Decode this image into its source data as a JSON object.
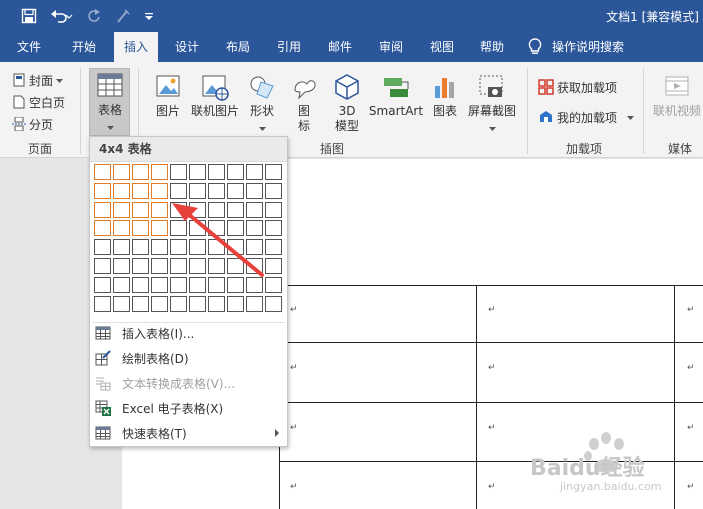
{
  "title_bar": {
    "document_title": "文档1 [兼容模式]",
    "quick_access": [
      {
        "icon": "save-icon"
      },
      {
        "icon": "undo-icon"
      },
      {
        "icon": "redo-icon"
      },
      {
        "icon": "format-painter-icon"
      },
      {
        "icon": "customize-qat-icon"
      }
    ]
  },
  "tabs": [
    {
      "label": "文件"
    },
    {
      "label": "开始"
    },
    {
      "label": "插入",
      "active": true
    },
    {
      "label": "设计"
    },
    {
      "label": "布局"
    },
    {
      "label": "引用"
    },
    {
      "label": "邮件"
    },
    {
      "label": "审阅"
    },
    {
      "label": "视图"
    },
    {
      "label": "帮助"
    },
    {
      "label": "操作说明搜索",
      "icon": "lightbulb-icon"
    }
  ],
  "ribbon": {
    "pages_group": {
      "label": "页面",
      "items": [
        {
          "label": "封面",
          "icon": "cover-page-icon",
          "has_dropdown": true
        },
        {
          "label": "空白页",
          "icon": "blank-page-icon"
        },
        {
          "label": "分页",
          "icon": "page-break-icon"
        }
      ]
    },
    "table_button": {
      "label": "表格",
      "icon": "table-icon"
    },
    "illustrations_group": {
      "label": "插图",
      "items": [
        {
          "label": "图片",
          "icon": "picture-icon"
        },
        {
          "label": "联机图片",
          "icon": "online-picture-icon"
        },
        {
          "label": "形状",
          "icon": "shapes-icon",
          "has_dropdown": true
        },
        {
          "label_line1": "图",
          "label_line2": "标",
          "icon": "icons-icon"
        },
        {
          "label_line1": "3D",
          "label_line2": "模型",
          "icon": "3d-model-icon"
        },
        {
          "label": "SmartArt",
          "icon": "smartart-icon"
        },
        {
          "label": "图表",
          "icon": "chart-icon"
        },
        {
          "label": "屏幕截图",
          "icon": "screenshot-icon",
          "has_dropdown": true
        }
      ]
    },
    "addins_group": {
      "label": "加载项",
      "items": [
        {
          "label": "获取加载项",
          "icon": "store-icon"
        },
        {
          "label": "我的加载项",
          "icon": "my-addins-icon",
          "has_dropdown": true
        }
      ]
    },
    "media_group": {
      "label": "媒体",
      "items": [
        {
          "label": "联机视频",
          "icon": "online-video-icon",
          "disabled": true
        }
      ]
    }
  },
  "table_dropdown": {
    "header": "4x4 表格",
    "grid": {
      "columns": 10,
      "rows": 8,
      "selected_columns": 4,
      "selected_rows": 4
    },
    "menu_items": [
      {
        "label": "插入表格(I)...",
        "icon": "insert-table-icon",
        "disabled": false
      },
      {
        "label": "绘制表格(D)",
        "icon": "draw-table-icon",
        "disabled": false
      },
      {
        "label": "文本转换成表格(V)...",
        "icon": "convert-text-icon",
        "disabled": true
      },
      {
        "label": "Excel 电子表格(X)",
        "icon": "excel-icon",
        "disabled": false
      },
      {
        "label": "快速表格(T)",
        "icon": "quick-tables-icon",
        "disabled": false,
        "has_submenu": true
      }
    ]
  },
  "document": {
    "paragraph_mark": "↵"
  },
  "watermark": {
    "brand": "Baidu经验",
    "url": "jingyan.baidu.com"
  },
  "colors": {
    "title_bar": "#2b579a",
    "selection_orange": "#e07b27",
    "arrow_red": "#e8413c"
  }
}
